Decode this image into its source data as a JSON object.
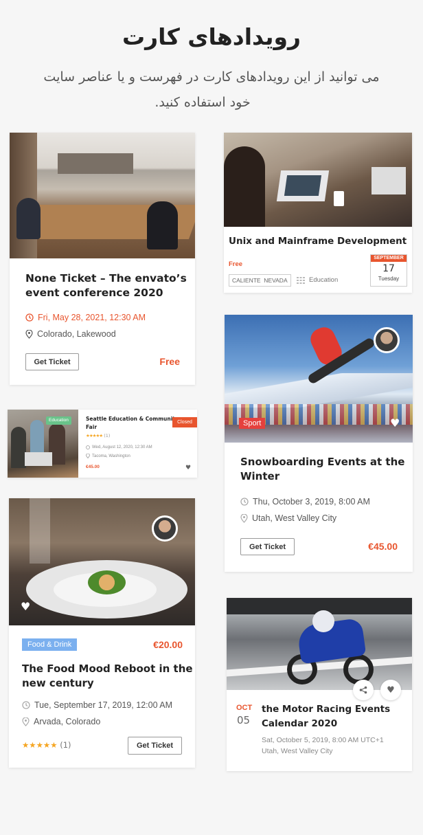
{
  "header": {
    "title": "رویدادهای کارت",
    "subtitle_line1": "می توانید از این رویدادهای کارت در فهرست و یا عناصر سایت",
    "subtitle_line2": "خود استفاده کنید."
  },
  "colors": {
    "accent": "#e8552e",
    "sport_red": "#e5413d",
    "food_blue": "#7bb0ef",
    "education_green": "#69c38a",
    "star": "#f5a623"
  },
  "card1": {
    "title_line1": "None Ticket – The envato’s",
    "title_line2": "event conference 2020",
    "date": "Fri, May 28, 2021, 12:30 AM",
    "location": "Colorado, Lakewood",
    "button": "Get Ticket",
    "price": "Free"
  },
  "card2": {
    "title": "Unix and Mainframe Development",
    "price": "Free",
    "tags": "CALIENTE  NEVADA",
    "category": "Education",
    "date_month": "SEPTEMBER",
    "date_day": "17",
    "date_weekday": "Tuesday"
  },
  "card3": {
    "badge": "Education",
    "title_line1": "Seattle Education & Community",
    "title_line2": "Fair",
    "stars": "★★★★★",
    "rating_count": "(1)",
    "status": "Closed",
    "date": "Wed, August 12, 2020, 12:30 AM",
    "location": "Tacoma, Washington",
    "price": "€45.00"
  },
  "card4": {
    "badge": "Sport",
    "title_line1": "Snowboarding Events at the",
    "title_line2": "Winter",
    "date": "Thu, October 3, 2019, 8:00 AM",
    "location": "Utah, West Valley City",
    "button": "Get Ticket",
    "price": "€45.00"
  },
  "card5": {
    "badge": "Food & Drink",
    "price": "€20.00",
    "title_line1": "The Food Mood Reboot in the",
    "title_line2": "new century",
    "date": "Tue, September 17, 2019, 12:00 AM",
    "location": "Arvada, Colorado",
    "stars": "★★★★★",
    "rating_count": "(1)",
    "button": "Get Ticket"
  },
  "card6": {
    "month": "OCT",
    "day": "05",
    "title_line1": "the Motor Racing Events",
    "title_line2": "Calendar 2020",
    "date": "Sat, October 5, 2019, 8:00 AM UTC+1",
    "location": "Utah, West Valley City"
  }
}
